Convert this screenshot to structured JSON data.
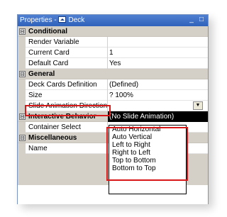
{
  "window": {
    "title": "Properties -",
    "object": "Deck",
    "minimize": "_",
    "close": "□"
  },
  "categories": {
    "conditional": {
      "label": "Conditional",
      "toggle": "⊟"
    },
    "general": {
      "label": "General",
      "toggle": "⊟"
    },
    "interactive": {
      "label": "Interactive Behavior",
      "toggle": "⊟"
    },
    "misc": {
      "label": "Miscellaneous",
      "toggle": "⊟"
    }
  },
  "properties": {
    "render_variable": {
      "name": "Render Variable",
      "value": ""
    },
    "current_card": {
      "name": "Current Card",
      "value": "1"
    },
    "default_card": {
      "name": "Default Card",
      "value": "Yes"
    },
    "deck_cards_definition": {
      "name": "Deck Cards Definition",
      "value": "(Defined)"
    },
    "size": {
      "name": "Size",
      "value": "? 100%"
    },
    "slide_animation_direction": {
      "name": "Slide Animation Direction",
      "value": "(No Slide Animation)"
    },
    "container_select": {
      "name": "Container Select",
      "value": ""
    },
    "name": {
      "name": "Name",
      "value": ""
    }
  },
  "dropdown": {
    "arrow": "▼",
    "options": [
      "Auto Horizontal",
      "Auto Vertical",
      "Left to Right",
      "Right to Left",
      "Top to Bottom",
      "Bottom to Top"
    ]
  },
  "colors": {
    "highlight": "#d81818",
    "titlebar": "#3a6cc4"
  }
}
